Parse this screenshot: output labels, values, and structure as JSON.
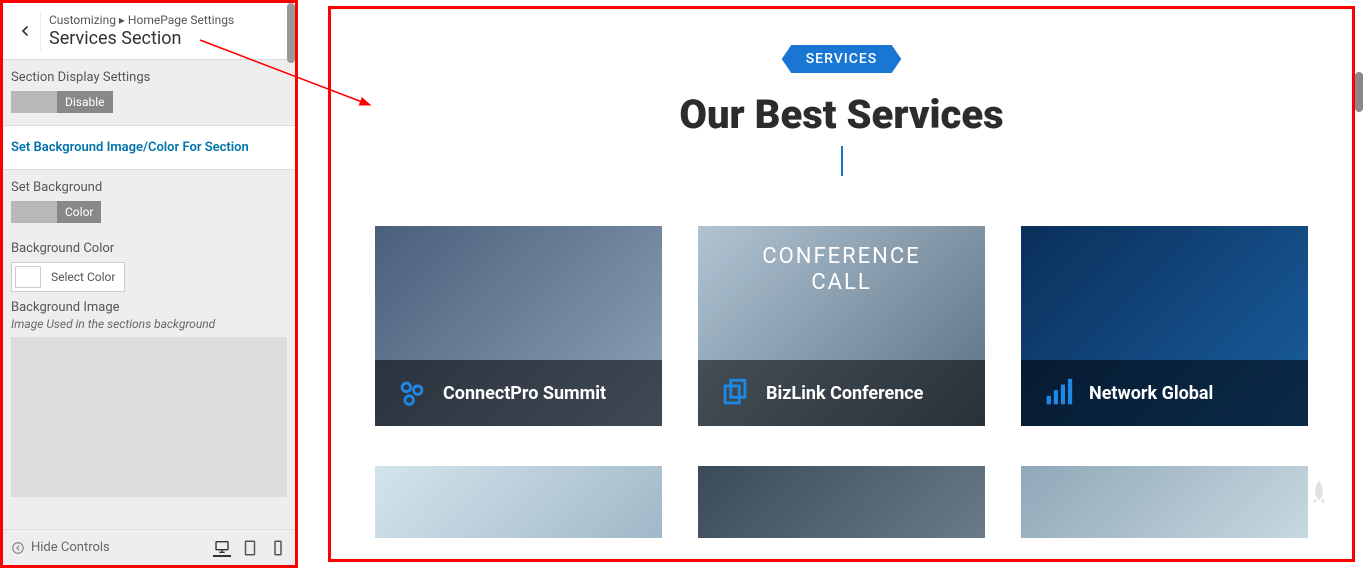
{
  "breadcrumb": "Customizing ▸ HomePage Settings",
  "section_title": "Services Section",
  "sidebar": {
    "display_label": "Section Display Settings",
    "display_toggle": "Disable",
    "bg_link": "Set Background Image/Color For Section",
    "set_bg_label": "Set Background",
    "set_bg_toggle": "Color",
    "bg_color_label": "Background Color",
    "select_color": "Select Color",
    "bg_image_label": "Background Image",
    "bg_image_desc": "Image Used in the sections background"
  },
  "footer": {
    "hide_controls": "Hide Controls"
  },
  "preview": {
    "badge": "SERVICES",
    "title": "Our Best Services",
    "cards": [
      {
        "title": "ConnectPro Summit"
      },
      {
        "title": "BizLink Conference"
      },
      {
        "title": "Network Global"
      }
    ]
  }
}
